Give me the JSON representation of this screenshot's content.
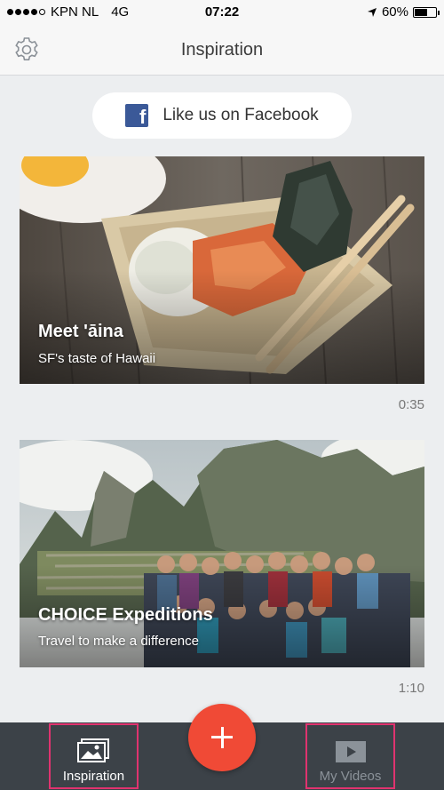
{
  "status_bar": {
    "carrier": "KPN NL",
    "network": "4G",
    "time": "07:22",
    "battery": "60%",
    "battery_level": 0.6,
    "signal_bars": 4
  },
  "nav": {
    "title": "Inspiration",
    "settings_icon": "gear-icon"
  },
  "facebook": {
    "label": "Like us on Facebook",
    "icon": "facebook-icon",
    "brand_color": "#3b5998"
  },
  "cards": [
    {
      "title": "Meet 'āina",
      "subtitle": "SF's taste of Hawaii",
      "duration": "0:35"
    },
    {
      "title": "CHOICE Expeditions",
      "subtitle": "Travel to make a difference",
      "duration": "1:10"
    }
  ],
  "tab_bar": {
    "inspiration_label": "Inspiration",
    "inspiration_icon": "photo-icon",
    "videos_label": "My Videos",
    "videos_icon": "play-icon",
    "add_icon": "plus-icon",
    "accent": "#f04a36"
  }
}
